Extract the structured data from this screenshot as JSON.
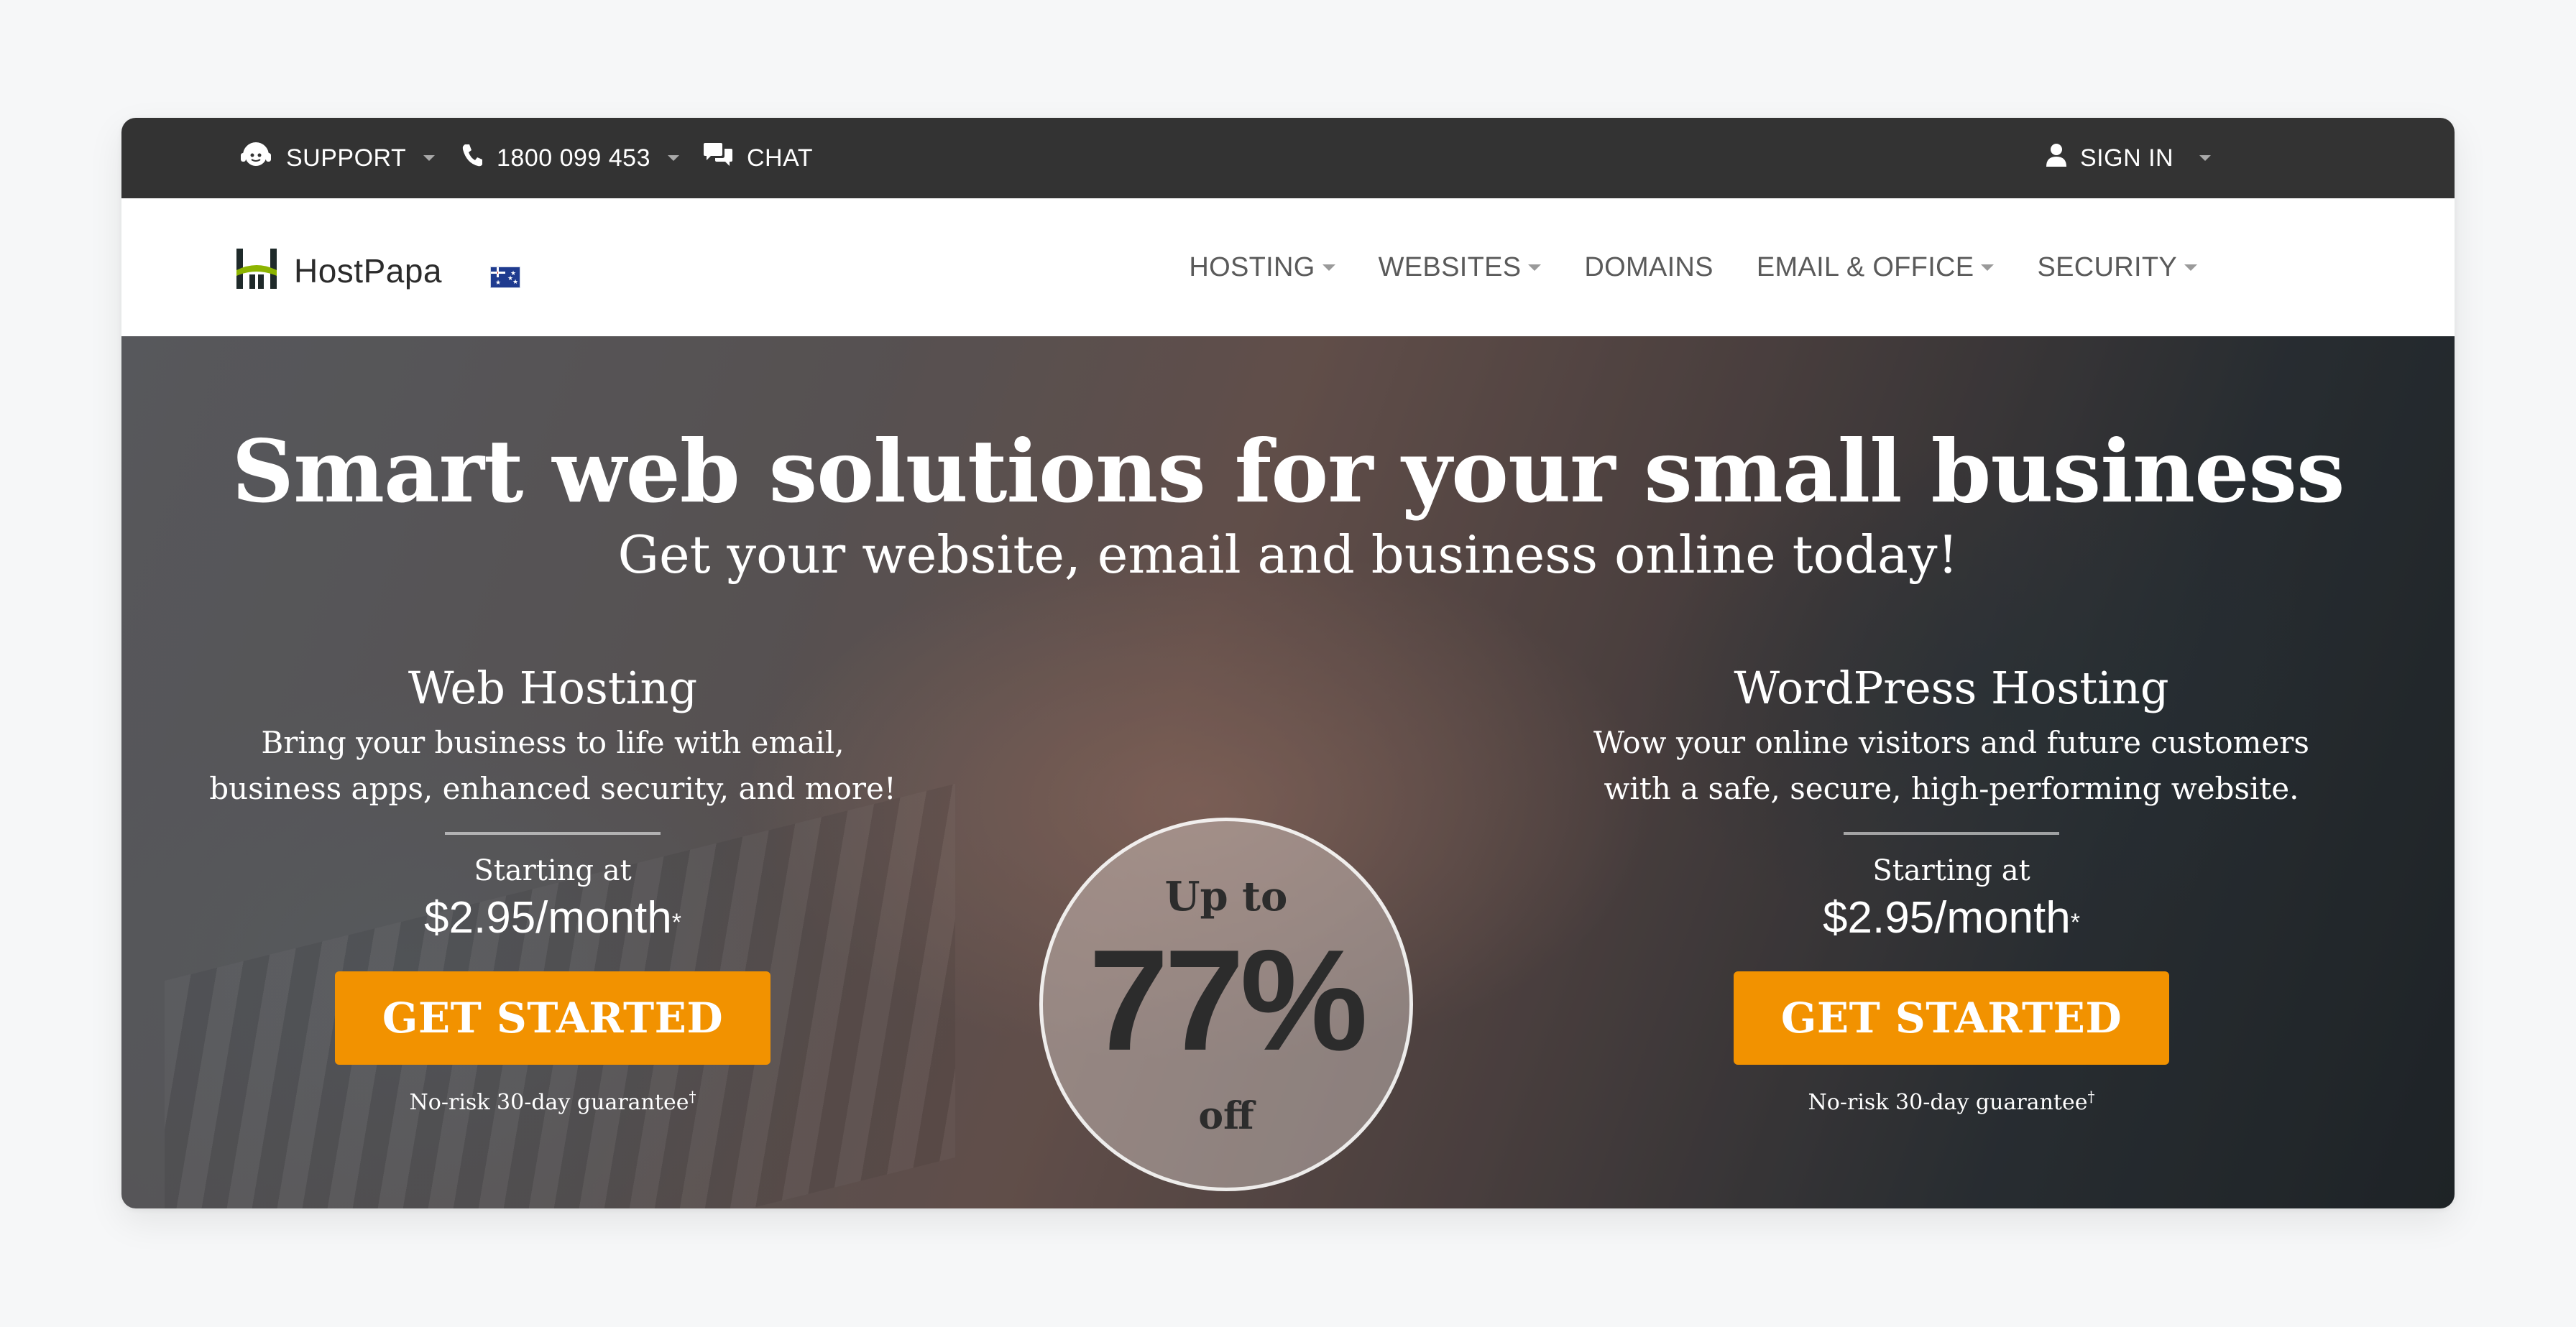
{
  "topbar": {
    "support_label": "SUPPORT",
    "phone_label": "1800 099 453",
    "chat_label": "CHAT",
    "signin_label": "SIGN IN"
  },
  "header": {
    "logo_text": "HostPapa",
    "nav": [
      {
        "label": "HOSTING",
        "has_dropdown": true
      },
      {
        "label": "WEBSITES",
        "has_dropdown": true
      },
      {
        "label": "DOMAINS",
        "has_dropdown": false
      },
      {
        "label": "EMAIL & OFFICE",
        "has_dropdown": true
      },
      {
        "label": "SECURITY",
        "has_dropdown": true
      }
    ]
  },
  "hero": {
    "title": "Smart web solutions for your small business",
    "subtitle": "Get your website, email and business online today!",
    "badge": {
      "top": "Up to",
      "percent": "77%",
      "bottom": "off"
    },
    "plans": [
      {
        "title": "Web Hosting",
        "description": "Bring your business to life with email, business apps, enhanced security, and more!",
        "starting_label": "Starting at",
        "price": "$2.95/month",
        "price_mark": "*",
        "cta_label": "GET STARTED",
        "guarantee": "No-risk 30-day guarantee",
        "guarantee_mark": "†"
      },
      {
        "title": "WordPress Hosting",
        "description": "Wow your online visitors and future customers with a safe, secure, high-performing website.",
        "starting_label": "Starting at",
        "price": "$2.95/month",
        "price_mark": "*",
        "cta_label": "GET STARTED",
        "guarantee": "No-risk 30-day guarantee",
        "guarantee_mark": "†"
      }
    ]
  },
  "colors": {
    "topbar_bg": "#333333",
    "cta_orange": "#f29200",
    "logo_green": "#8db400",
    "logo_dark": "#1f2a2a"
  },
  "icons": [
    "support-agent-icon",
    "phone-icon",
    "chat-bubbles-icon",
    "user-icon",
    "hostpapa-logo-icon",
    "australia-flag-icon"
  ]
}
